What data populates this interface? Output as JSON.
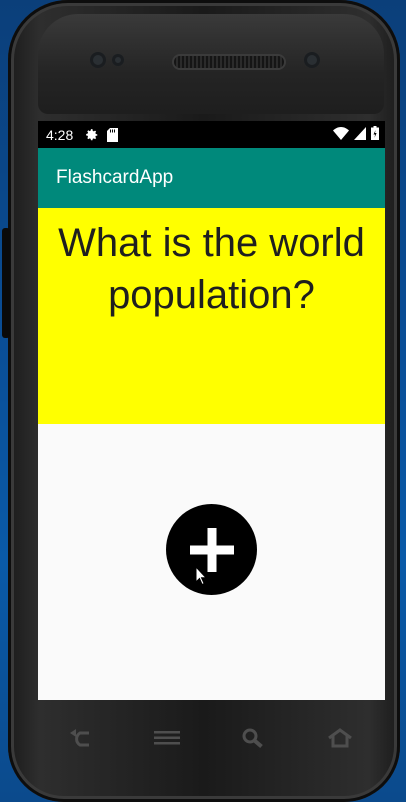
{
  "status": {
    "time": "4:28"
  },
  "app": {
    "title": "FlashcardApp"
  },
  "card": {
    "question": "What is the world population?"
  },
  "colors": {
    "appbar": "#00897b",
    "card_bg": "#ffff00",
    "fab": "#000000"
  },
  "icons": {
    "status": [
      "settings-icon",
      "sd-card-icon",
      "wifi-icon",
      "signal-icon",
      "battery-icon"
    ],
    "fab": "plus-icon",
    "nav": [
      "back-icon",
      "menu-icon",
      "search-icon",
      "home-icon"
    ]
  }
}
